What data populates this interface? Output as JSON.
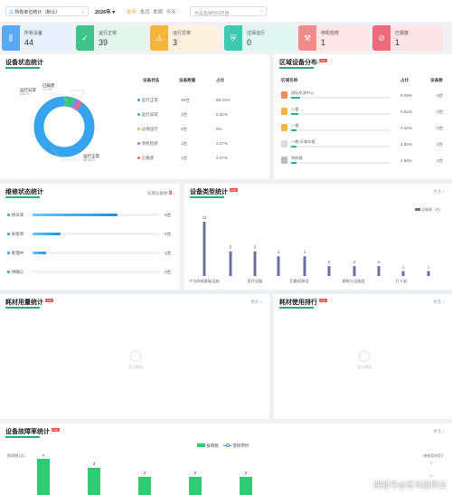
{
  "toolbar": {
    "unit_select": "所有单位统计（默认）",
    "year_select": "2026年",
    "tabs": [
      "本年",
      "本月",
      "本周",
      "今天"
    ],
    "date_placeholder": "点击选择时间范围"
  },
  "stats": [
    {
      "label": "所有设备",
      "value": "44",
      "icon": "device-bars-icon",
      "color": "#5aa9f0",
      "bg": "#e6f1fc"
    },
    {
      "label": "运行正常",
      "value": "39",
      "icon": "check-circle-icon",
      "color": "#3ec48a",
      "bg": "#e3f6ec"
    },
    {
      "label": "运行异常",
      "value": "3",
      "icon": "warning-icon",
      "color": "#f5b53c",
      "bg": "#fdf2df"
    },
    {
      "label": "过保运行",
      "value": "0",
      "icon": "shield-check-icon",
      "color": "#3ec9b0",
      "bg": "#e0f6f1"
    },
    {
      "label": "停机检修",
      "value": "1",
      "icon": "wrench-icon",
      "color": "#f38b8b",
      "bg": "#fde6e6"
    },
    {
      "label": "已报废",
      "value": "1",
      "icon": "ban-icon",
      "color": "#ee6a7a",
      "bg": "#fbe3e6"
    }
  ],
  "device_status": {
    "title": "设备状态统计",
    "headers": [
      "设备状态",
      "设备数量",
      "占比"
    ],
    "rows": [
      {
        "name": "运行正常",
        "count": "39台",
        "pct": "88.64%",
        "color": "#35a3ee"
      },
      {
        "name": "运行异常",
        "count": "3台",
        "pct": "6.82%",
        "color": "#3ec48a"
      },
      {
        "name": "过保运行",
        "count": "0台",
        "pct": "0%",
        "color": "#f5b53c"
      },
      {
        "name": "停机检修",
        "count": "1台",
        "pct": "2.27%",
        "color": "#9f7af0"
      },
      {
        "name": "已报废",
        "count": "1台",
        "pct": "2.27%",
        "color": "#ee6a7a"
      }
    ],
    "labels": {
      "normal": "运行正常",
      "normal_pct": "88.64%",
      "abnormal": "运行异常",
      "abnormal_pct": "6.82%",
      "scrapped": "已报废",
      "scrapped_pct": "2.27%"
    }
  },
  "region": {
    "title": "区域设备分布",
    "headers": [
      "区域名称",
      "占比",
      "设备数"
    ],
    "rows": [
      {
        "name": "国际交流中心",
        "pct": "9.09%",
        "count": "4台",
        "bar": 0.09
      },
      {
        "name": "二楼",
        "pct": "6.82%",
        "count": "3台",
        "bar": 0.07
      },
      {
        "name": "一楼",
        "pct": "4.55%",
        "count": "2台",
        "bar": 0.05
      },
      {
        "name": "一期-开拿东楼",
        "pct": "4.55%",
        "count": "2台",
        "bar": 0.05
      },
      {
        "name": "琴韵楼",
        "pct": "4.55%",
        "count": "2台",
        "bar": 0.05
      }
    ]
  },
  "repair": {
    "title": "维修状态统计",
    "sub_label": "同期设备数",
    "sub_value": "9",
    "rows": [
      {
        "name": "待派单",
        "count": "6台",
        "bar": 0.67
      },
      {
        "name": "未接单",
        "count": "2台",
        "bar": 0.22
      },
      {
        "name": "处理中",
        "count": "1台",
        "bar": 0.11
      },
      {
        "name": "待确认",
        "count": "0台",
        "bar": 0
      }
    ]
  },
  "type_stats": {
    "title": "设备类型统计",
    "more": "更多 >",
    "legend": "设备数（台）"
  },
  "chart_data": [
    {
      "type": "bar",
      "title": "设备类型统计",
      "categories": [
        "IT与网络基础设施",
        "",
        "医疗设备",
        "",
        "后勤保障设",
        "",
        "建筑与设施类",
        "",
        "打卡机",
        "",
        ""
      ],
      "values": [
        11,
        5,
        5,
        4,
        4,
        2,
        2,
        2,
        1,
        1,
        1
      ],
      "legend": "设备数（台）",
      "ylim": [
        0,
        11
      ]
    },
    {
      "type": "bar",
      "title": "设备故障率统计",
      "categories": [
        "",
        "",
        "",
        "",
        ""
      ],
      "series": [
        {
          "name": "报障数",
          "values": [
            4,
            3,
            2,
            2,
            2
          ]
        }
      ],
      "ylabel": "报障数(次)",
      "y2label": "借修用时(h)",
      "legend": [
        "报障数",
        "借修用时"
      ]
    }
  ],
  "consumables": {
    "title": "耗材用量统计",
    "more": "更多 >",
    "empty": "暂无数据"
  },
  "consumables_rank": {
    "title": "耗材使用排行",
    "more": "更多 >",
    "empty": "暂无数据"
  },
  "fault": {
    "title": "设备故障率统计",
    "legend_bar": "报障数",
    "legend_line": "借修用时",
    "ylabel": "报障数(次)",
    "y2label": "借修用时(h)",
    "y2_tick_top": "5",
    "y2_tick_mid": "4"
  },
  "badge_new": "new",
  "more_label": "更多 >",
  "watermark": "搜狐号@青鸟报修云"
}
